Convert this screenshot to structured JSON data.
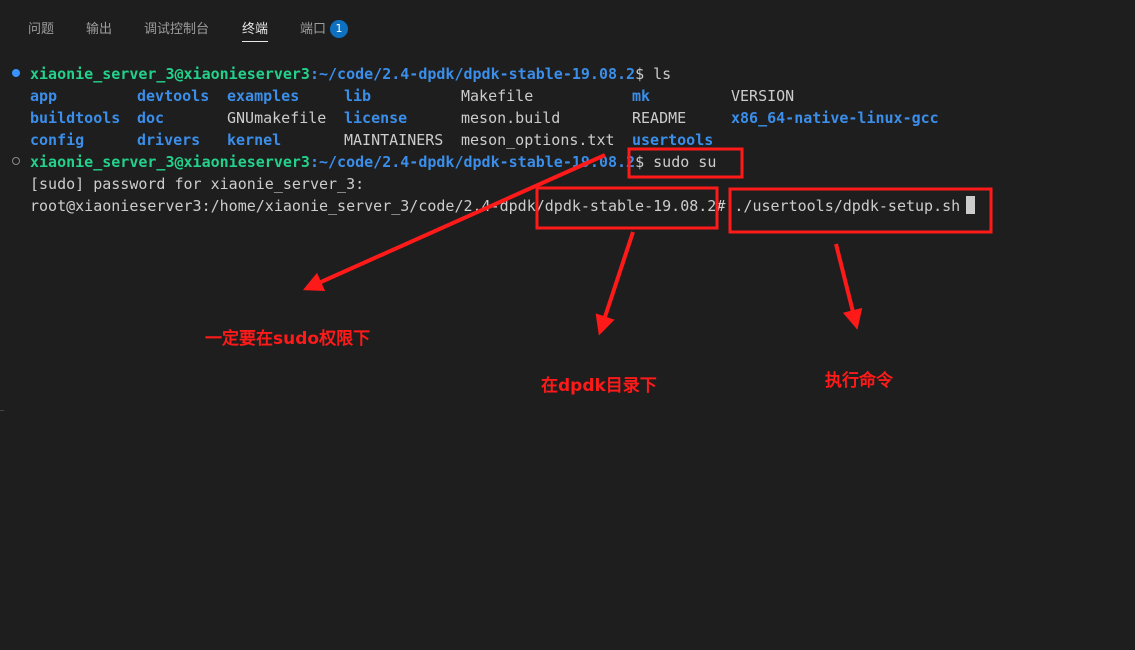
{
  "tabs": [
    {
      "label": "问题"
    },
    {
      "label": "输出"
    },
    {
      "label": "调试控制台"
    },
    {
      "label": "终端"
    },
    {
      "label": "端口",
      "badge": "1"
    }
  ],
  "terminal": {
    "prompt_user": "xiaonie_server_3@xiaonieserver3",
    "prompt_path": ":~/code/2.4-dpdk/dpdk-stable-19.08.2",
    "line1_cmd": "$ ls",
    "ls_rows": [
      [
        "app",
        "devtools",
        "examples",
        "lib",
        "Makefile",
        "mk",
        "VERSION"
      ],
      [
        "buildtools",
        "doc",
        "GNUmakefile",
        "license",
        "meson.build",
        "README",
        "x86_64-native-linux-gcc"
      ],
      [
        "config",
        "drivers",
        "kernel",
        "MAINTAINERS",
        "meson_options.txt",
        "usertools",
        ""
      ]
    ],
    "line5_cmd": "$ sudo su",
    "sudo_prompt": "[sudo] password for xiaonie_server_3:",
    "root_prompt": "root@xiaonieserver3:/home/xiaonie_server_3/code/2.4-dpdk/dpdk-stable-19.08.2#",
    "root_cmd": " ./usertools/dpdk-setup.sh"
  },
  "annotations": {
    "sudo_note": "一定要在sudo权限下",
    "dir_note": "在dpdk目录下",
    "cmd_note": "执行命令",
    "color": "#ff1a1a"
  }
}
